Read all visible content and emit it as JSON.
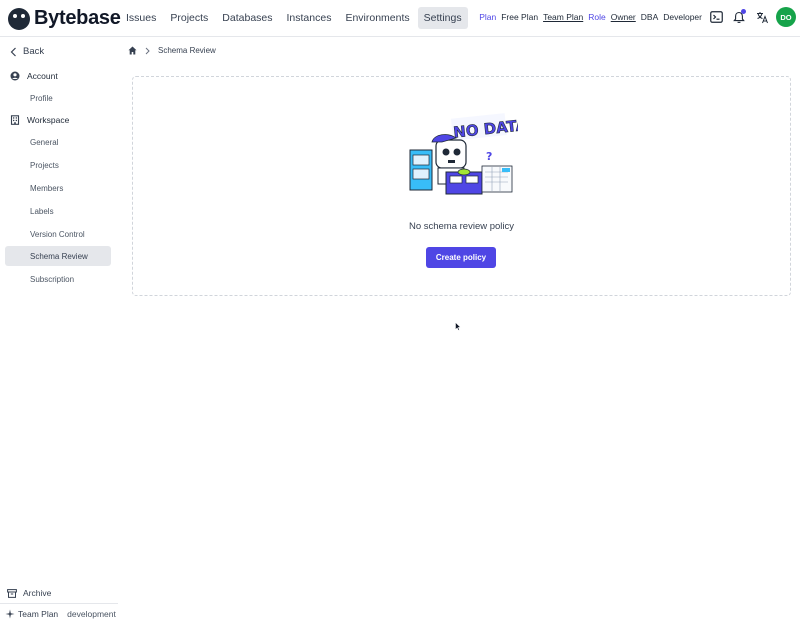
{
  "brand": {
    "name": "Bytebase"
  },
  "nav": {
    "items": [
      {
        "label": "Issues"
      },
      {
        "label": "Projects"
      },
      {
        "label": "Databases"
      },
      {
        "label": "Instances"
      },
      {
        "label": "Environments"
      },
      {
        "label": "Settings",
        "active": true
      }
    ]
  },
  "topright": {
    "plan_label": "Plan",
    "free_plan": "Free Plan",
    "team_plan": "Team Plan",
    "role_label": "Role",
    "owner": "Owner",
    "dba": "DBA",
    "developer": "Developer",
    "avatar_initials": "DO",
    "icons": [
      "terminal-icon",
      "bell-icon",
      "translate-icon"
    ]
  },
  "sidebar": {
    "back": "Back",
    "account": {
      "label": "Account",
      "items": [
        {
          "label": "Profile"
        }
      ]
    },
    "workspace": {
      "label": "Workspace",
      "items": [
        {
          "label": "General"
        },
        {
          "label": "Projects"
        },
        {
          "label": "Members"
        },
        {
          "label": "Labels"
        },
        {
          "label": "Version Control"
        },
        {
          "label": "Schema Review",
          "active": true
        },
        {
          "label": "Subscription"
        }
      ]
    },
    "archive": "Archive",
    "plan": "Team Plan",
    "environment": "development"
  },
  "breadcrumb": {
    "current": "Schema Review"
  },
  "empty_state": {
    "illustration_text": "NO DATA",
    "message": "No schema review policy",
    "button": "Create policy"
  },
  "colors": {
    "accent": "#4f46e5",
    "avatar": "#16a34a",
    "active_bg": "#e5e7eb"
  }
}
